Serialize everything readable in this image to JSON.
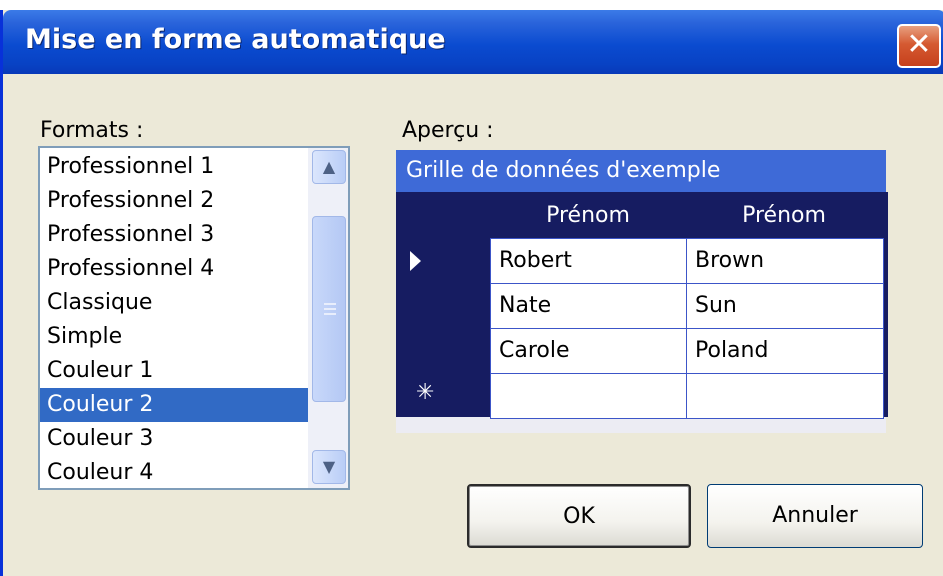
{
  "window": {
    "title": "Mise en forme automatique",
    "close_glyph": "✕",
    "accent_color": "#0a4bd0"
  },
  "formats": {
    "label": "Formats :",
    "items": [
      "Professionnel 1",
      "Professionnel 2",
      "Professionnel 3",
      "Professionnel 4",
      "Classique",
      "Simple",
      "Couleur 1",
      "Couleur 2",
      "Couleur 3",
      "Couleur 4"
    ],
    "selected": "Couleur 2",
    "scroll_up_icon": "chevron-up-icon",
    "scroll_down_icon": "chevron-down-icon"
  },
  "preview": {
    "label": "Aperçu :",
    "caption": "Grille de données d'exemple",
    "columns": [
      "Prénom",
      "Prénom"
    ],
    "rows": [
      [
        "Robert",
        "Brown"
      ],
      [
        "Nate",
        "Sun"
      ],
      [
        "Carole",
        "Poland"
      ]
    ],
    "new_row_marker": "✳",
    "caption_color": "#3e6ad7",
    "grid_color": "#161c61"
  },
  "buttons": {
    "ok": "OK",
    "cancel": "Annuler"
  }
}
